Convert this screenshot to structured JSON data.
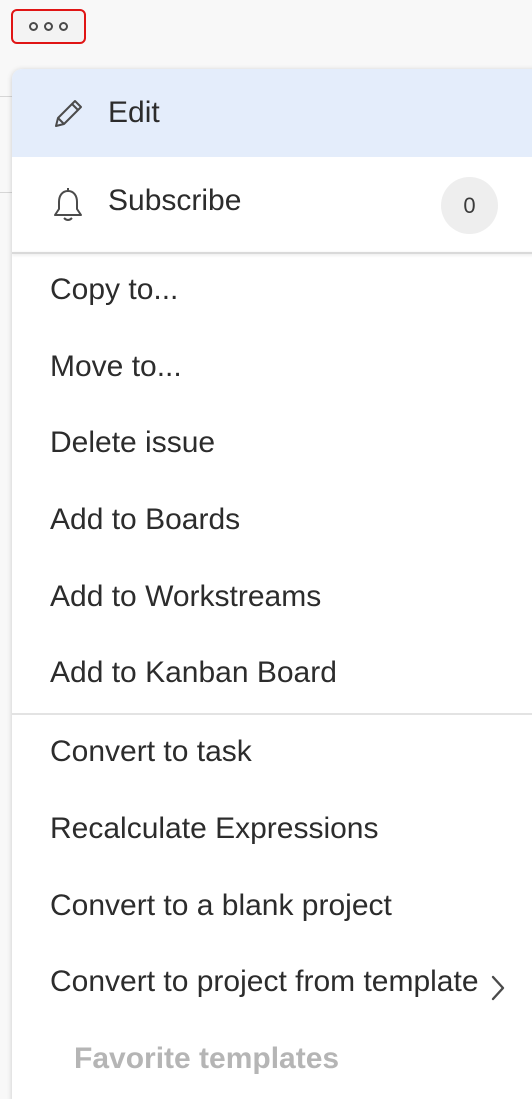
{
  "more_button": {
    "icon": "more-horizontal-icon",
    "highlight_color": "#e01515"
  },
  "menu": {
    "edit": {
      "label": "Edit",
      "icon": "pencil-icon",
      "bg_color": "#e4edfb"
    },
    "subscribe": {
      "label": "Subscribe",
      "icon": "bell-icon",
      "count": "0"
    },
    "items": [
      {
        "label": "Copy to..."
      },
      {
        "label": "Move to..."
      },
      {
        "label": "Delete issue"
      },
      {
        "label": "Add to Boards"
      },
      {
        "label": "Add to Workstreams"
      },
      {
        "label": "Add to Kanban Board"
      },
      {
        "label": "Convert to task"
      },
      {
        "label": "Recalculate Expressions"
      },
      {
        "label": "Convert to a blank project"
      },
      {
        "label": "Convert to project from template"
      }
    ],
    "favorite_templates": {
      "label": "Favorite templates",
      "icon": "chevron-right-icon",
      "disabled": true
    }
  }
}
